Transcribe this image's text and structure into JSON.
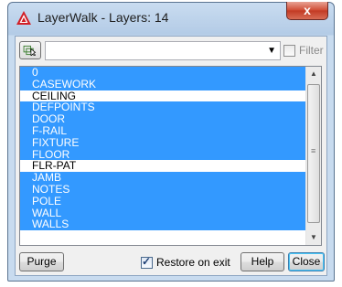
{
  "window": {
    "title": "LayerWalk - Layers: 14",
    "close_glyph": "x"
  },
  "toolbar": {
    "select_objects_icon": "select-objects-icon",
    "combo_value": "",
    "combo_arrow": "▼",
    "filter_label": "Filter",
    "filter_checked": false
  },
  "layers": {
    "items": [
      {
        "label": "0",
        "selected": true
      },
      {
        "label": "CASEWORK",
        "selected": true
      },
      {
        "label": "CEILING",
        "selected": false
      },
      {
        "label": "DEFPOINTS",
        "selected": true
      },
      {
        "label": "DOOR",
        "selected": true
      },
      {
        "label": "F-RAIL",
        "selected": true
      },
      {
        "label": "FIXTURE",
        "selected": true
      },
      {
        "label": "FLOOR",
        "selected": true
      },
      {
        "label": "FLR-PAT",
        "selected": false
      },
      {
        "label": "JAMB",
        "selected": true
      },
      {
        "label": "NOTES",
        "selected": true
      },
      {
        "label": "POLE",
        "selected": true
      },
      {
        "label": "WALL",
        "selected": true
      },
      {
        "label": "WALLS",
        "selected": true
      }
    ]
  },
  "scrollbar": {
    "up_glyph": "▲",
    "down_glyph": "▼",
    "grip_glyph": "≡"
  },
  "footer": {
    "purge_label": "Purge",
    "restore_label": "Restore on exit",
    "restore_checked": true,
    "check_glyph": "✓",
    "help_label": "Help",
    "close_label": "Close"
  },
  "colors": {
    "selection": "#3399ff",
    "title_close": "#c23a23"
  }
}
